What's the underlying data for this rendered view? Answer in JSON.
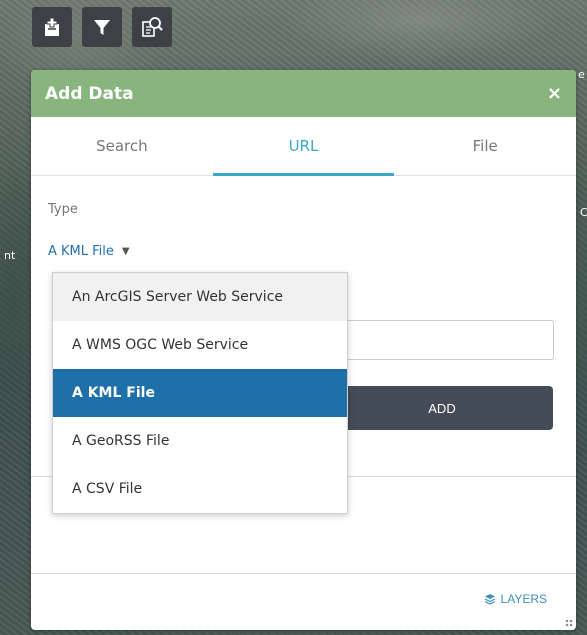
{
  "map": {
    "left_edge_label": "nt",
    "right_edge_label_1": "e",
    "right_edge_label_2": "C"
  },
  "toolbar": {
    "buttons": [
      {
        "icon": "add-data-icon"
      },
      {
        "icon": "filter-icon"
      },
      {
        "icon": "query-icon"
      }
    ]
  },
  "panel": {
    "title": "Add Data",
    "close_label": "×",
    "tabs": [
      {
        "label": "Search",
        "active": false
      },
      {
        "label": "URL",
        "active": true
      },
      {
        "label": "File",
        "active": false
      }
    ],
    "type_label": "Type",
    "type_selected": "A KML File",
    "add_label": "ADD",
    "layers_label": "LAYERS"
  },
  "dropdown": {
    "options": [
      "An ArcGIS Server Web Service",
      "A WMS OGC Web Service",
      "A KML File",
      "A GeoRSS File",
      "A CSV File"
    ],
    "selected": "A KML File"
  },
  "colors": {
    "header": "#88b47d",
    "accent": "#3aa7c6",
    "selected": "#1f6fa9",
    "button": "#434c57"
  }
}
